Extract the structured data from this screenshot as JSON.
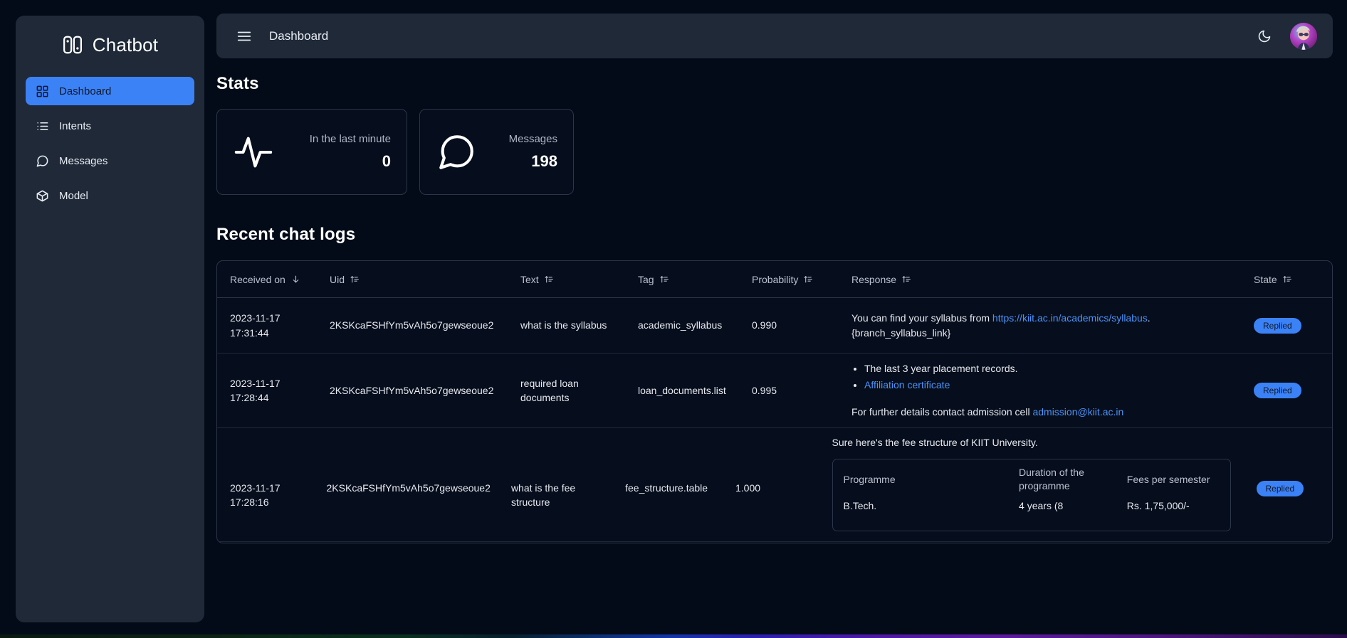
{
  "brand": {
    "name": "Chatbot",
    "logo_icon": "chatbot-logo-icon"
  },
  "sidebar": {
    "items": [
      {
        "label": "Dashboard",
        "icon": "grid-icon",
        "active": true
      },
      {
        "label": "Intents",
        "icon": "list-icon",
        "active": false
      },
      {
        "label": "Messages",
        "icon": "chat-bubble-icon",
        "active": false
      },
      {
        "label": "Model",
        "icon": "box-icon",
        "active": false
      }
    ]
  },
  "topbar": {
    "menu_icon": "hamburger-icon",
    "title": "Dashboard",
    "theme_icon": "moon-icon",
    "avatar_alt": "user-avatar"
  },
  "stats": {
    "title": "Stats",
    "cards": [
      {
        "icon": "activity-pulse-icon",
        "label": "In the last minute",
        "value": "0"
      },
      {
        "icon": "message-bubble-icon",
        "label": "Messages",
        "value": "198"
      }
    ]
  },
  "logs": {
    "title": "Recent chat logs",
    "columns": [
      {
        "label": "Received on",
        "sort": "down"
      },
      {
        "label": "Uid",
        "sort": "updown"
      },
      {
        "label": "Text",
        "sort": "updown"
      },
      {
        "label": "Tag",
        "sort": "updown"
      },
      {
        "label": "Probability",
        "sort": "updown"
      },
      {
        "label": "Response",
        "sort": "updown"
      },
      {
        "label": "State",
        "sort": "updown"
      }
    ],
    "rows": [
      {
        "date": "2023-11-17",
        "time": "17:31:44",
        "uid": "2KSKcaFSHfYm5vAh5o7gewseoue2",
        "text": "what is the syllabus",
        "tag": "academic_syllabus",
        "probability": "0.990",
        "response": {
          "kind": "text",
          "prefix": "You can find your syllabus from ",
          "link": "https://kiit.ac.in/academics/syllabus",
          "suffix": ".",
          "second_line": "{branch_syllabus_link}"
        },
        "state": "Replied"
      },
      {
        "date": "2023-11-17",
        "time": "17:28:44",
        "uid": "2KSKcaFSHfYm5vAh5o7gewseoue2",
        "text": "required loan documents",
        "tag": "loan_documents.list",
        "probability": "0.995",
        "response": {
          "kind": "list",
          "items": [
            {
              "text": "The last 3 year placement records.",
              "is_link": false
            },
            {
              "text": "Affiliation certificate",
              "is_link": true
            }
          ],
          "footer_prefix": "For further details contact admission cell ",
          "footer_link": "admission@kiit.ac.in"
        },
        "state": "Replied"
      },
      {
        "date": "2023-11-17",
        "time": "17:28:16",
        "uid": "2KSKcaFSHfYm5vAh5o7gewseoue2",
        "text": "what is the fee structure",
        "tag": "fee_structure.table",
        "probability": "1.000",
        "response": {
          "kind": "table",
          "intro": "Sure here's the fee structure of KIIT University.",
          "table": {
            "headers": [
              "Programme",
              "Duration of the programme",
              "Fees per semester"
            ],
            "rows": [
              [
                "B.Tech.",
                "4 years (8",
                "Rs. 1,75,000/-"
              ]
            ]
          }
        },
        "state": "Replied"
      }
    ]
  },
  "colors": {
    "accent": "#3b82f6",
    "sidebar_bg": "#1f2937",
    "page_bg": "#040b18",
    "card_bg": "#060d1c",
    "link": "#4b93f7",
    "border": "#2b3648"
  }
}
